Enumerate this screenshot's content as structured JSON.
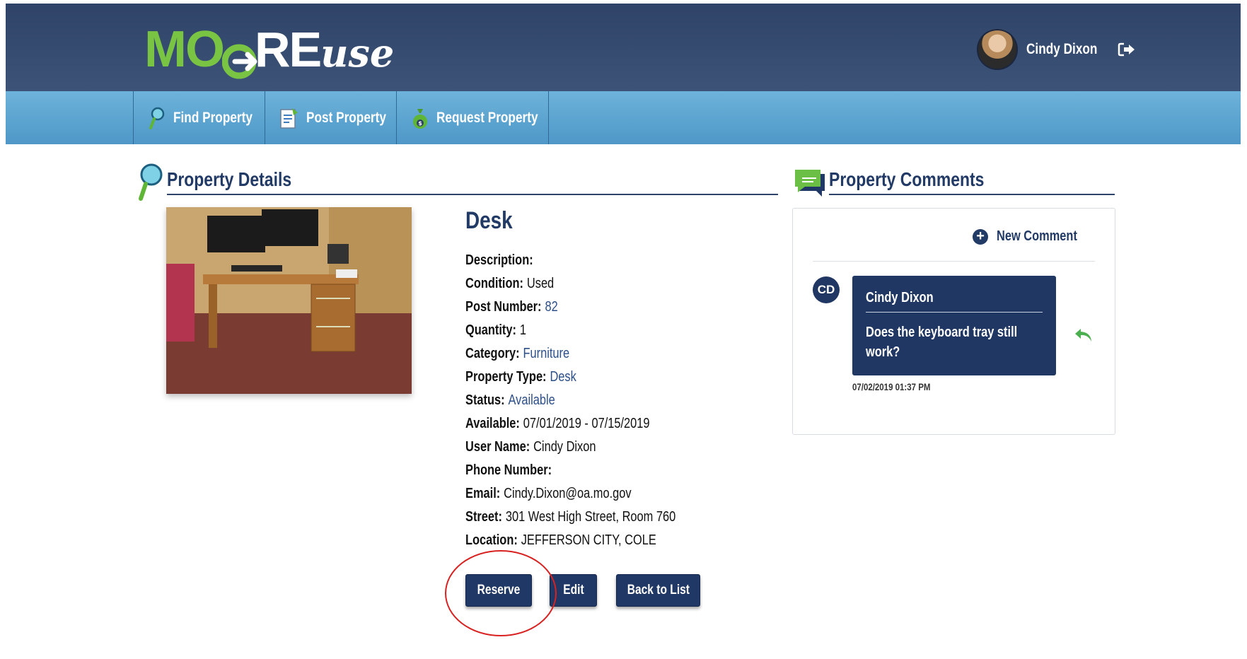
{
  "header": {
    "logo": {
      "part1": "MO",
      "part2": "RE",
      "part3": "use"
    },
    "user_name": "Cindy Dixon"
  },
  "nav": [
    {
      "label": "Find Property",
      "icon": "magnifier-icon"
    },
    {
      "label": "Post Property",
      "icon": "document-icon"
    },
    {
      "label": "Request Property",
      "icon": "money-bag-icon"
    }
  ],
  "details": {
    "section_title": "Property Details",
    "title": "Desk",
    "fields": [
      {
        "label": "Description:",
        "value": ""
      },
      {
        "label": "Condition:",
        "value": "Used"
      },
      {
        "label": "Post Number:",
        "value": "82"
      },
      {
        "label": "Quantity:",
        "value": "1"
      },
      {
        "label": "Category:",
        "value": "Furniture"
      },
      {
        "label": "Property Type:",
        "value": "Desk"
      },
      {
        "label": "Status:",
        "value": "Available"
      },
      {
        "label": "Available:",
        "value": "07/01/2019 - 07/15/2019"
      },
      {
        "label": "User Name:",
        "value": "Cindy Dixon"
      },
      {
        "label": "Phone Number:",
        "value": ""
      },
      {
        "label": "Email:",
        "value": "Cindy.Dixon@oa.mo.gov"
      },
      {
        "label": "Street:",
        "value": "301 West High Street, Room 760"
      },
      {
        "label": "Location:",
        "value": "JEFFERSON CITY, COLE"
      }
    ],
    "buttons": {
      "reserve": "Reserve",
      "edit": "Edit",
      "back": "Back to List"
    }
  },
  "comments": {
    "section_title": "Property Comments",
    "new_comment_label": "New Comment",
    "items": [
      {
        "initials": "CD",
        "author": "Cindy Dixon",
        "text": "Does the keyboard tray still work?",
        "timestamp": "07/02/2019 01:37 PM"
      }
    ]
  },
  "colors": {
    "header": "#2e4367",
    "nav": "#5aa5d3",
    "brand_green": "#79c443",
    "button": "#203865",
    "annotation": "#d82222"
  }
}
